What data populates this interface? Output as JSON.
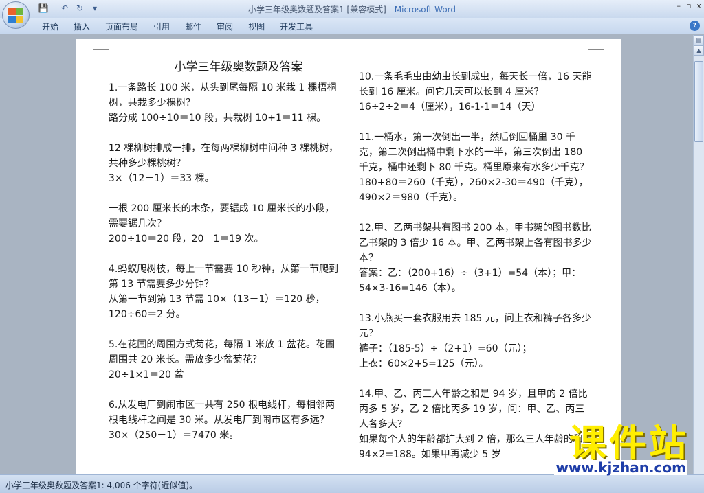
{
  "window": {
    "doc_name": "小学三年级奥数题及答案1 [兼容模式] - ",
    "app_name": "Microsoft Word",
    "controls": [
      "–",
      "▫",
      "x"
    ]
  },
  "qat": {
    "save": "💾",
    "undo": "↶",
    "redo": "↻",
    "more": "▾"
  },
  "ribbon": {
    "tabs": [
      "开始",
      "插入",
      "页面布局",
      "引用",
      "邮件",
      "审阅",
      "视图",
      "开发工具"
    ],
    "help": "?"
  },
  "document": {
    "title": "小学三年级奥数题及答案",
    "left_column": [
      "1.一条路长 100 米，从头到尾每隔 10 米栽 1 棵梧桐树，共栽多少棵树？",
      "路分成 100÷10＝10 段，共栽树 10+1＝11 棵。",
      "",
      "12 棵柳树排成一排，在每两棵柳树中间种 3 棵桃树，共种多少棵桃树？",
      "3×（12－1）＝33 棵。",
      "",
      "一根 200 厘米长的木条，要锯成 10 厘米长的小段，需要锯几次？",
      "200÷10＝20 段，20－1＝19 次。",
      "",
      "4.蚂蚁爬树枝，每上一节需要 10 秒钟，从第一节爬到第 13 节需要多少分钟？",
      "从第一节到第 13 节需 10×（13－1）＝120 秒，120÷60＝2 分。",
      "",
      "5.在花圃的周围方式菊花，每隔 1 米放 1 盆花。花圃周围共 20 米长。需放多少盆菊花？",
      "20÷1×1＝20 盆",
      "",
      "6.从发电厂到闹市区一共有 250 根电线杆，每相邻两根电线杆之间是 30 米。从发电厂到闹市区有多远？",
      "30×（250－1）＝7470 米。"
    ],
    "right_column": [
      "10.一条毛毛虫由幼虫长到成虫，每天长一倍，16 天能长到 16 厘米。问它几天可以长到 4 厘米？",
      "16÷2÷2＝4（厘米），16-1-1＝14（天）",
      "",
      "11.一桶水，第一次倒出一半，然后倒回桶里 30 千克，第二次倒出桶中剩下水的一半，第三次倒出 180 千克，桶中还剩下 80 千克。桶里原来有水多少千克？",
      "180+80＝260（千克），260×2-30＝490（千克），490×2＝980（千克）。",
      "",
      "12.甲、乙两书架共有图书 200 本，甲书架的图书数比乙书架的 3 倍少 16 本。甲、乙两书架上各有图书多少本？",
      "答案：乙：（200+16）÷（3+1）=54（本）；甲：54×3-16=146（本）。",
      "",
      "13.小燕买一套衣服用去 185 元，问上衣和裤子各多少元？",
      "裤子：（185-5）÷（2+1）=60（元）；",
      "上衣：60×2+5=125（元）。",
      "",
      "14.甲、乙、丙三人年龄之和是 94 岁，且甲的 2 倍比丙多 5 岁，乙 2 倍比丙多 19 岁，问：甲、乙、丙三人各多大？",
      "如果每个人的年龄都扩大到 2 倍，那么三人年龄的和是 94×2=188。如果甲再减少 5 岁"
    ]
  },
  "status": {
    "text": "小学三年级奥数题及答案1: 4,006 个字符(近似值)。"
  },
  "watermark": {
    "cn": "课件站",
    "url": "www.kjzhan.com"
  }
}
